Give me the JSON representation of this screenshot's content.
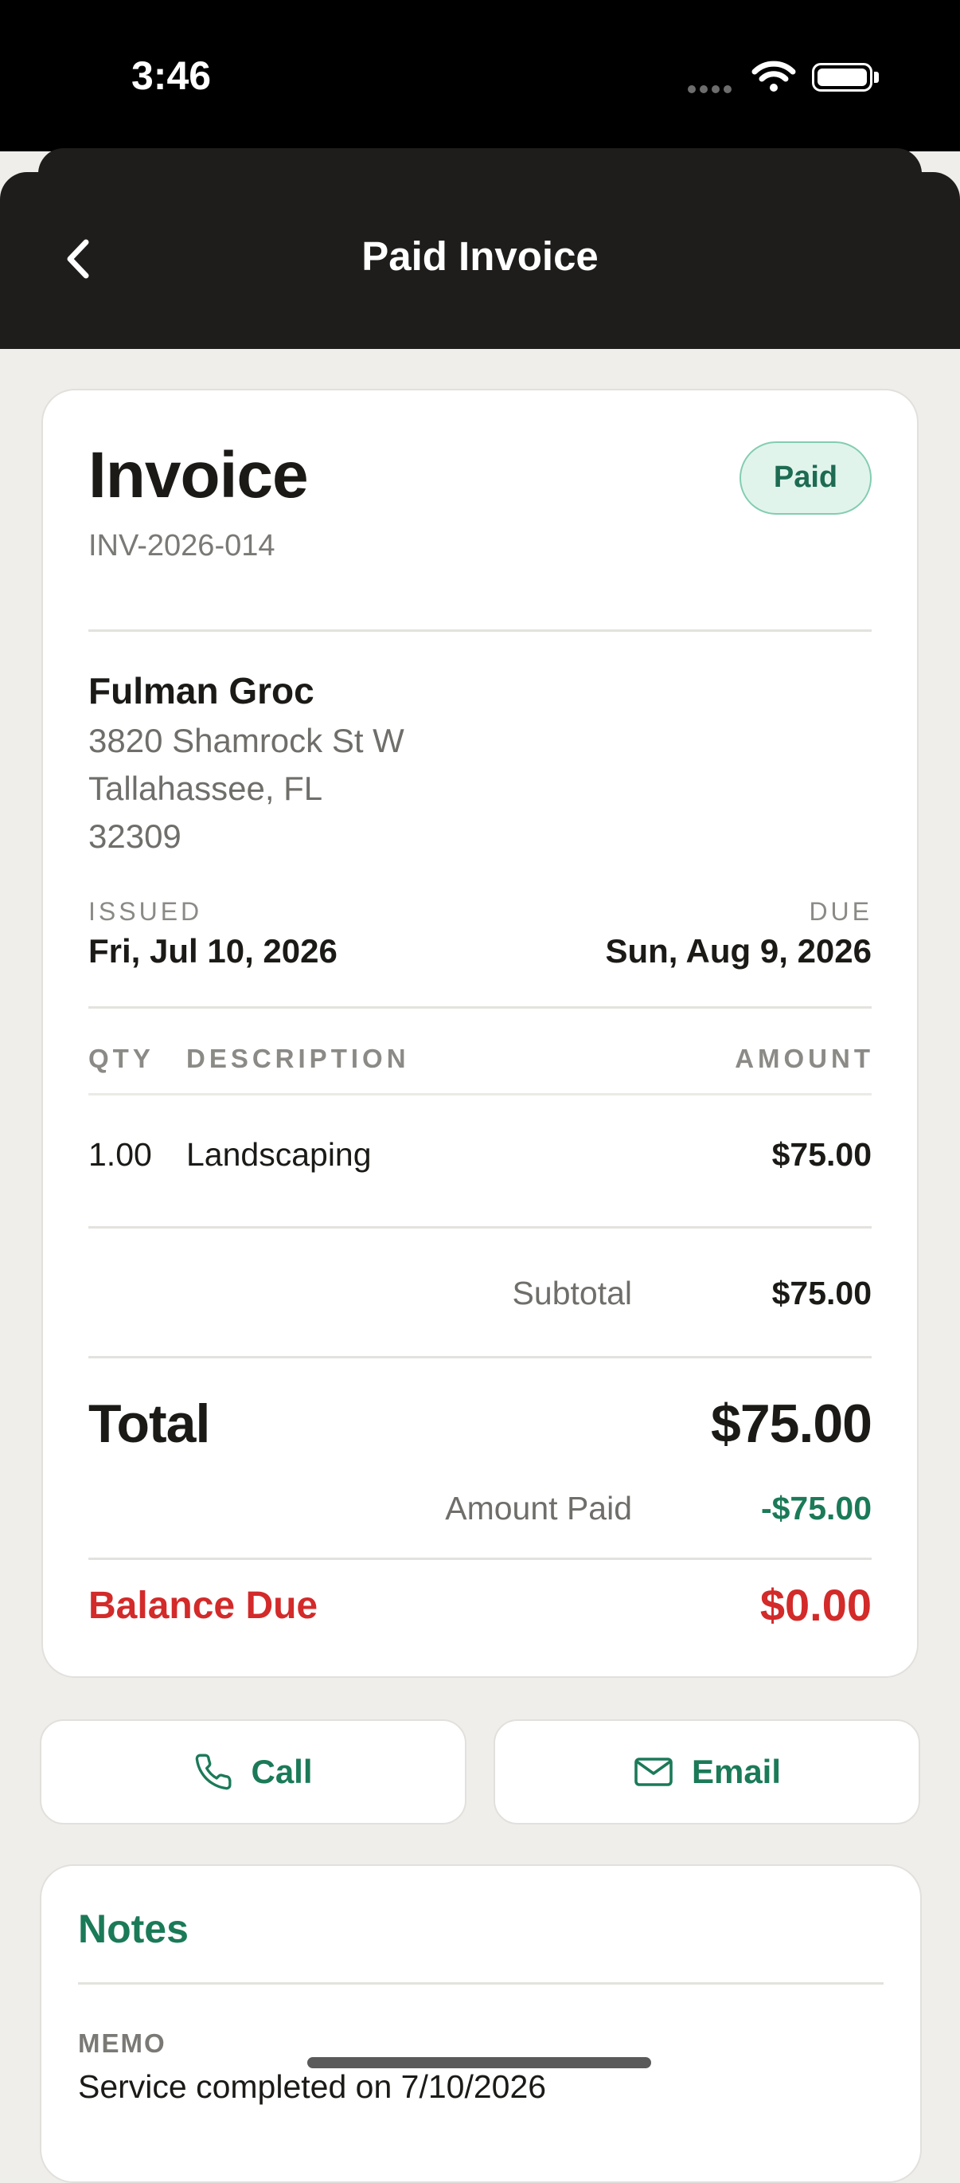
{
  "status": {
    "time": "3:46"
  },
  "nav": {
    "title": "Paid Invoice",
    "back_icon": "chevron-left-icon"
  },
  "invoice": {
    "heading": "Invoice",
    "number": "INV-2026-014",
    "status_badge": "Paid",
    "customer": {
      "name": "Fulman Groc",
      "address_line1": "3820 Shamrock St W",
      "address_line2": "Tallahassee, FL",
      "address_line3": "32309"
    },
    "issued_label": "ISSUED",
    "issued_date": "Fri, Jul 10, 2026",
    "due_label": "DUE",
    "due_date": "Sun, Aug 9, 2026",
    "columns": {
      "qty": "QTY",
      "description": "DESCRIPTION",
      "amount": "AMOUNT"
    },
    "line_items": [
      {
        "qty": "1.00",
        "description": "Landscaping",
        "amount": "$75.00"
      }
    ],
    "subtotal_label": "Subtotal",
    "subtotal": "$75.00",
    "total_label": "Total",
    "total": "$75.00",
    "amount_paid_label": "Amount Paid",
    "amount_paid": "-$75.00",
    "balance_due_label": "Balance Due",
    "balance_due": "$0.00"
  },
  "actions": {
    "call_label": "Call",
    "call_icon": "phone-icon",
    "email_label": "Email",
    "email_icon": "mail-icon"
  },
  "notes": {
    "title": "Notes",
    "memo_label": "MEMO",
    "memo_text": "Service completed on 7/10/2026"
  },
  "colors": {
    "accent": "#1b7a58",
    "danger": "#d32a2a",
    "nav_bg": "#1f1d1b",
    "page_bg": "#efeeea",
    "badge_bg": "#e1f4ec"
  }
}
